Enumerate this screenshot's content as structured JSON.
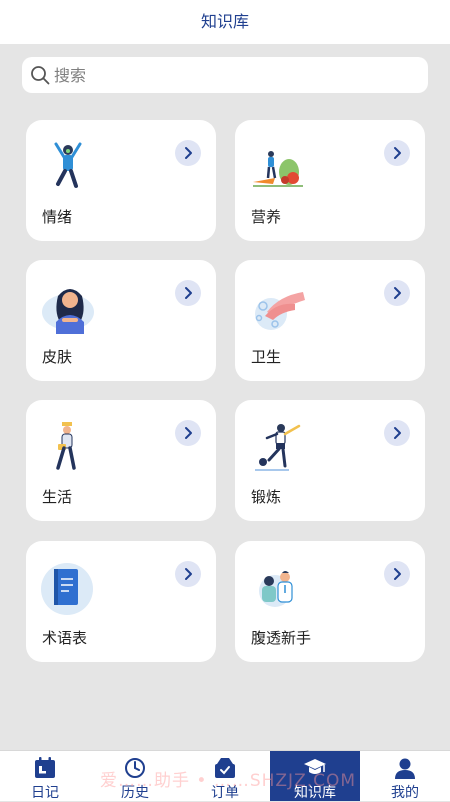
{
  "header": {
    "title": "知识库"
  },
  "search": {
    "placeholder": "搜索"
  },
  "cards": [
    {
      "label": "情绪",
      "icon": "person-cheering-icon"
    },
    {
      "label": "营养",
      "icon": "vegetables-icon"
    },
    {
      "label": "皮肤",
      "icon": "woman-skincare-icon"
    },
    {
      "label": "卫生",
      "icon": "hand-washing-icon"
    },
    {
      "label": "生活",
      "icon": "person-walking-icon"
    },
    {
      "label": "锻炼",
      "icon": "person-kicking-ball-icon"
    },
    {
      "label": "术语表",
      "icon": "book-icon"
    },
    {
      "label": "腹透新手",
      "icon": "doctor-patient-icon"
    }
  ],
  "tabs": [
    {
      "label": "日记",
      "icon": "calendar-icon",
      "active": false
    },
    {
      "label": "历史",
      "icon": "clock-icon",
      "active": false
    },
    {
      "label": "订单",
      "icon": "order-box-icon",
      "active": false
    },
    {
      "label": "知识库",
      "icon": "graduation-cap-icon",
      "active": true
    },
    {
      "label": "我的",
      "icon": "user-icon",
      "active": false
    }
  ],
  "watermark": "爱……助手 • ……SHZJZ.COM",
  "colors": {
    "primary": "#1f3f8f",
    "background": "#e5e5e5",
    "arrow_circle": "#dfe4f4"
  }
}
